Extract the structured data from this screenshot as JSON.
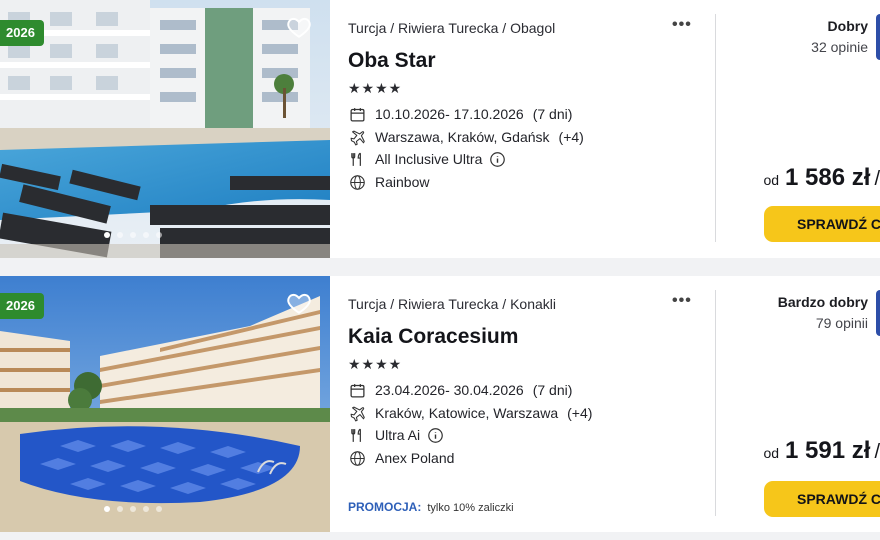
{
  "listings": [
    {
      "badge": "2026",
      "breadcrumb": "Turcja / Riwiera Turecka / Obagol",
      "name": "Oba Star",
      "stars": "★★★★",
      "dates": "10.10.2026- 17.10.2026",
      "duration": "(7 dni)",
      "airports": "Warszawa, Kraków, Gdańsk",
      "airports_more": "(+4)",
      "board": "All Inclusive Ultra",
      "operator": "Rainbow",
      "rating_word": "Dobry",
      "rating_count": "32 opinie",
      "price_prefix": "od",
      "price": "1 586 zł",
      "price_suffix": "/",
      "cta": "SPRAWDŹ CEN",
      "more": "•••"
    },
    {
      "badge": "2026",
      "breadcrumb": "Turcja / Riwiera Turecka / Konakli",
      "name": "Kaia Coracesium",
      "stars": "★★★★",
      "dates": "23.04.2026- 30.04.2026",
      "duration": "(7 dni)",
      "airports": "Kraków, Katowice, Warszawa",
      "airports_more": "(+4)",
      "board": "Ultra Ai",
      "operator": "Anex Poland",
      "promo_label": "PROMOCJA:",
      "promo_text": "tylko 10% zaliczki",
      "rating_word": "Bardzo dobry",
      "rating_count": "79 opinii",
      "price_prefix": "od",
      "price": "1 591 zł",
      "price_suffix": "/",
      "cta": "SPRAWDŹ CEN",
      "more": "•••"
    }
  ],
  "colors": {
    "badge": "#2e8b2e",
    "cta": "#f6c61a",
    "promo": "#2d5fb8",
    "score": "#2d4ea8"
  },
  "icons": [
    "calendar-icon",
    "plane-icon",
    "meal-icon",
    "info-icon",
    "globe-icon",
    "heart-icon",
    "more-icon"
  ]
}
